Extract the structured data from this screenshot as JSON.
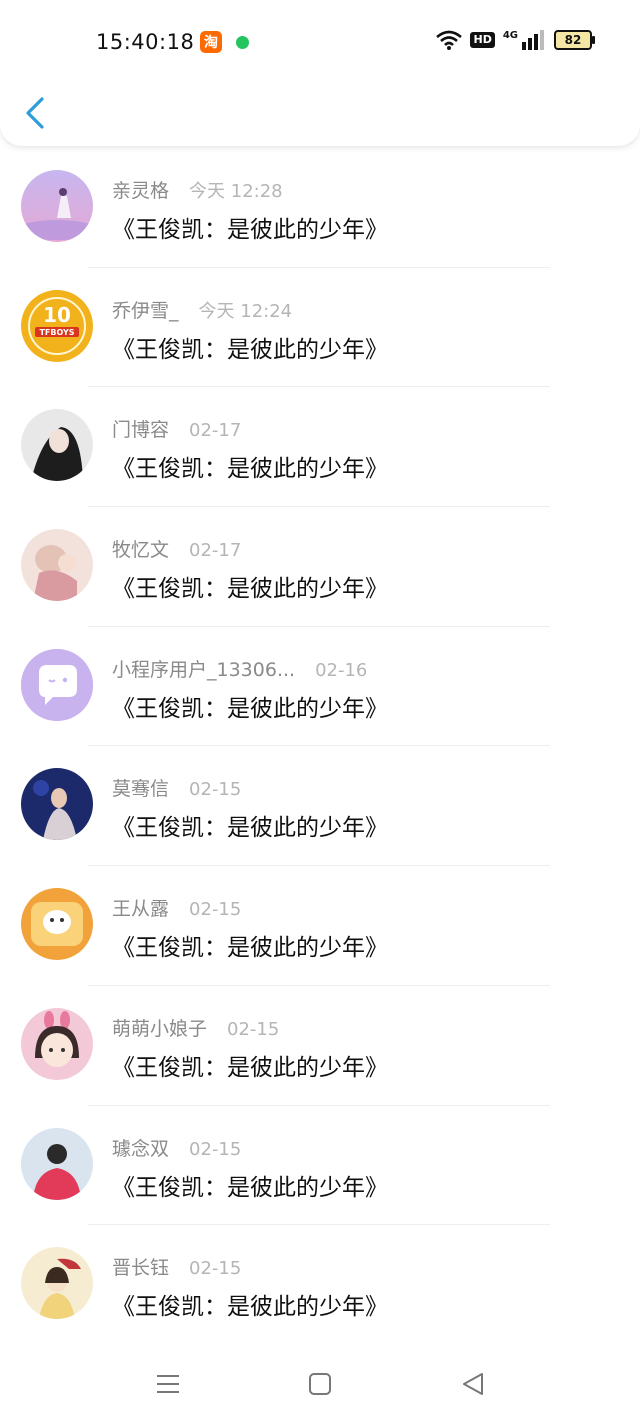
{
  "status_bar": {
    "time": "15:40:18",
    "taobao_icon_label": "淘",
    "hd_label": "HD",
    "network_label": "4G",
    "battery_level": "82"
  },
  "header": {
    "back_icon": "chevron-left-icon"
  },
  "messages": [
    {
      "name": "亲灵格",
      "time": "今天 12:28",
      "text": "《王俊凯：是彼此的少年》",
      "avatar_color": "#c9b7e6"
    },
    {
      "name": "乔伊雪_",
      "time": "今天 12:24",
      "text": "《王俊凯：是彼此的少年》",
      "avatar_color": "#f2b21c",
      "avatar_text": "TFBOYS"
    },
    {
      "name": "门博容",
      "time": "02-17",
      "text": "《王俊凯：是彼此的少年》",
      "avatar_color": "#2b2b2b"
    },
    {
      "name": "牧忆文",
      "time": "02-17",
      "text": "《王俊凯：是彼此的少年》",
      "avatar_color": "#e9c9c4"
    },
    {
      "name": "小程序用户_13306...",
      "time": "02-16",
      "text": "《王俊凯：是彼此的少年》",
      "avatar_color": "#c9b3ef"
    },
    {
      "name": "莫骞信",
      "time": "02-15",
      "text": "《王俊凯：是彼此的少年》",
      "avatar_color": "#1c2a6b"
    },
    {
      "name": "王从露",
      "time": "02-15",
      "text": "《王俊凯：是彼此的少年》",
      "avatar_color": "#f2a23a"
    },
    {
      "name": "萌萌小娘子",
      "time": "02-15",
      "text": "《王俊凯：是彼此的少年》",
      "avatar_color": "#f3c9d8"
    },
    {
      "name": "璩念双",
      "time": "02-15",
      "text": "《王俊凯：是彼此的少年》",
      "avatar_color": "#d9e4ef"
    },
    {
      "name": "晋长钰",
      "time": "02-15",
      "text": "《王俊凯：是彼此的少年》",
      "avatar_color": "#f5ecd2"
    }
  ],
  "nav": {
    "menu_icon": "menu-icon",
    "home_icon": "home-square-icon",
    "back_icon": "back-triangle-icon"
  }
}
